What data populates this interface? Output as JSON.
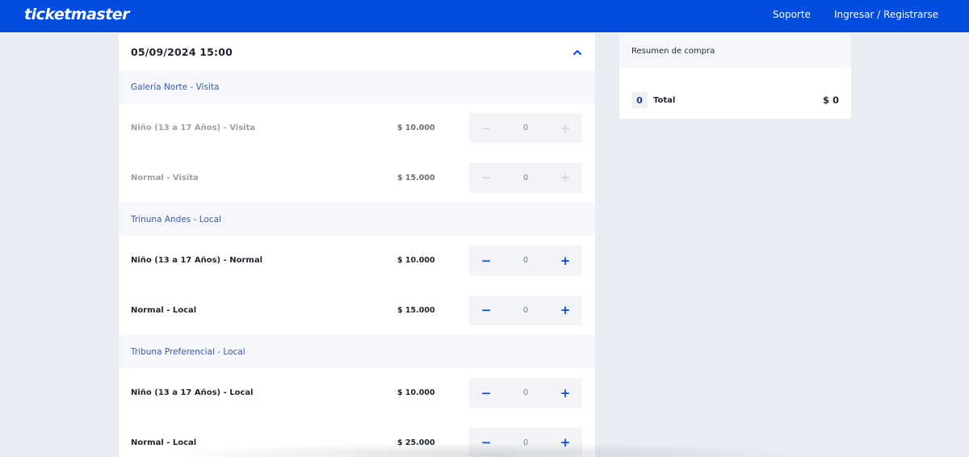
{
  "header": {
    "logo": "ticketmaster",
    "nav": {
      "support": "Soporte",
      "login": "Ingresar / Registrarse"
    },
    "colors": {
      "brand": "#024ddf"
    }
  },
  "event": {
    "datetime": "05/09/2024 15:00",
    "collapse_icon": "chevron-up-icon",
    "sections": [
      {
        "title": "Galería Norte - Visita",
        "tickets": [
          {
            "name": "Niño (13 a 17 Años) - Visita",
            "price": "$ 10.000",
            "qty": "0",
            "enabled": false
          },
          {
            "name": "Normal - Visita",
            "price": "$ 15.000",
            "qty": "0",
            "enabled": false
          }
        ]
      },
      {
        "title": "Trinuna Andes - Local",
        "tickets": [
          {
            "name": "Niño (13 a 17 Años) - Normal",
            "price": "$ 10.000",
            "qty": "0",
            "enabled": true
          },
          {
            "name": "Normal - Local",
            "price": "$ 15.000",
            "qty": "0",
            "enabled": true
          }
        ]
      },
      {
        "title": "Tribuna Preferencial - Local",
        "tickets": [
          {
            "name": "Niño (13 a 17 Años) - Local",
            "price": "$ 10.000",
            "qty": "0",
            "enabled": true
          },
          {
            "name": "Normal - Local",
            "price": "$ 25.000",
            "qty": "0",
            "enabled": true
          }
        ]
      }
    ]
  },
  "summary": {
    "title": "Resumen de compra",
    "qty": "0",
    "total_label": "Total",
    "total_value": "$ 0"
  },
  "icons": {
    "minus": "minus-icon",
    "plus": "plus-icon"
  }
}
